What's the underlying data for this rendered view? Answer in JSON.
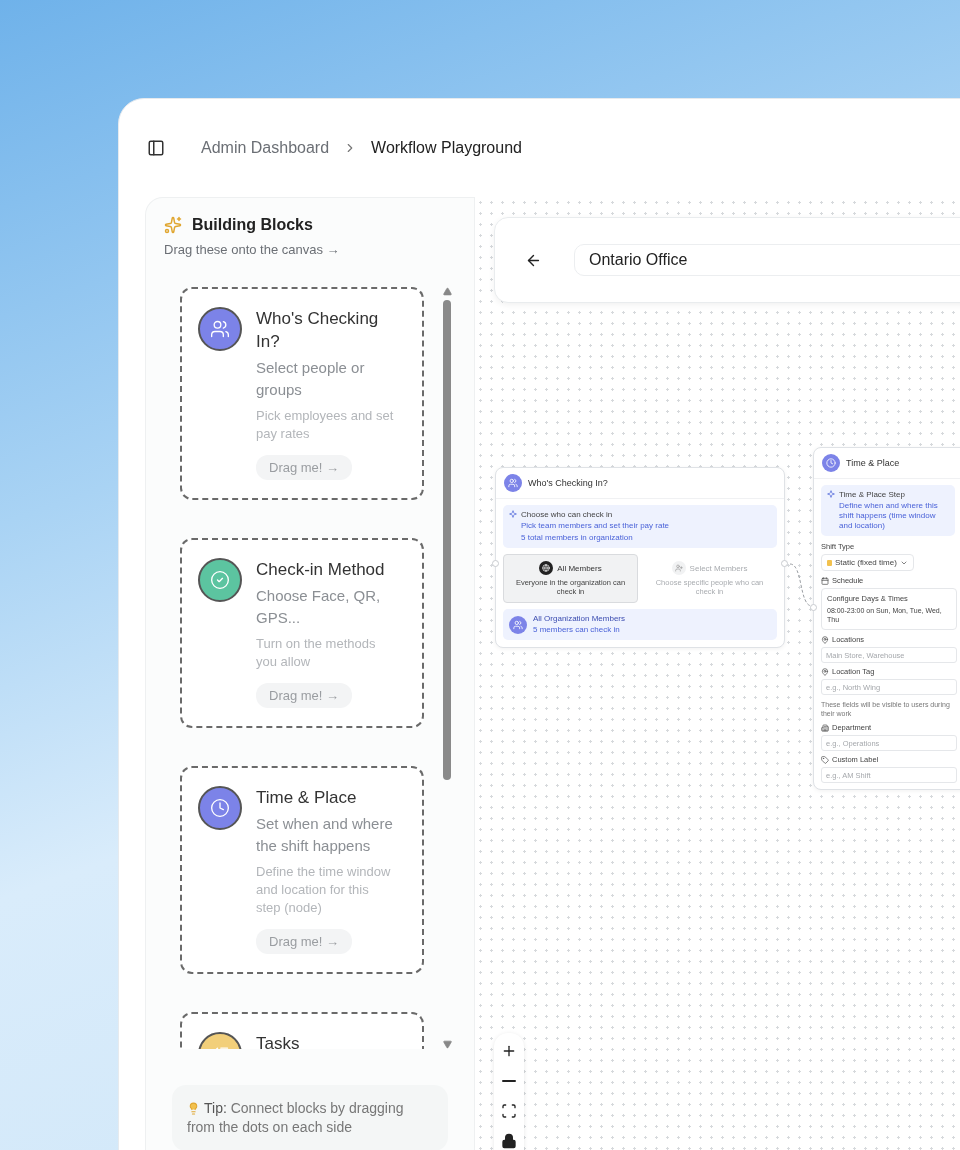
{
  "breadcrumb": [
    {
      "label": "Admin Dashboard",
      "current": false
    },
    {
      "label": "Workflow Playground",
      "current": true
    }
  ],
  "sidebar": {
    "title": "Building Blocks",
    "subtitle": "Drag these onto the canvas →",
    "blocks": [
      {
        "kind": "people",
        "color": "#7c83e8",
        "title": "Who's Checking In?",
        "subtitle": "Select people or groups",
        "description": "Pick employees and set pay rates",
        "action": "Drag me! →"
      },
      {
        "kind": "check",
        "color": "#5cc4a0",
        "title": "Check-in Method",
        "subtitle": "Choose Face, QR, GPS...",
        "description": "Turn on the methods you allow",
        "action": "Drag me! →"
      },
      {
        "kind": "clock",
        "color": "#7c83e8",
        "title": "Time & Place",
        "subtitle": "Set when and where the shift happens",
        "description": "Define the time window and location for this step (node)",
        "action": "Drag me! →"
      },
      {
        "kind": "tasks",
        "color": "#f2cf7a",
        "title": "Tasks"
      }
    ],
    "tip": {
      "label": "Tip:",
      "text": "Connect blocks by dragging from the dots on each side"
    }
  },
  "canvas": {
    "workflow_name": "Ontario Office",
    "who_node": {
      "title": "Who's Checking In?",
      "info_title": "Choose who can check in",
      "info_text": "Pick team members and set their pay rate",
      "info_count": "5 total members in organization",
      "options": [
        {
          "label": "All Members",
          "description": "Everyone in the organization can check in",
          "selected": true
        },
        {
          "label": "Select Members",
          "description": "Choose specific people who can check in",
          "selected": false
        }
      ],
      "summary_title": "All Organization Members",
      "summary_text": "5 members can check in"
    },
    "time_node": {
      "title": "Time & Place",
      "info_title": "Time & Place Step",
      "info_text": "Define when and where this shift happens (time window and location)",
      "shift_type_label": "Shift Type",
      "shift_type": "Static (fixed time)",
      "schedule_label": "Schedule",
      "schedule_title": "Configure Days & Times",
      "schedule_text": "08:00-23:00 on Sun, Mon, Tue, Wed, Thu",
      "fields_row1": [
        {
          "kind": "pin",
          "label": "Locations",
          "placeholder": "Main Store, Warehouse"
        },
        {
          "kind": "pin",
          "label": "Location Tag",
          "placeholder": "e.g., North Wing"
        }
      ],
      "note": "These fields will be visible to users during their work",
      "fields_row2": [
        {
          "kind": "building",
          "label": "Department",
          "placeholder": "e.g., Operations"
        },
        {
          "kind": "tag",
          "label": "Custom Label",
          "placeholder": "e.g., AM Shift"
        }
      ]
    },
    "zoom_controls": [
      {
        "kind": "zoom-in"
      },
      {
        "kind": "zoom-out"
      },
      {
        "kind": "fit"
      },
      {
        "kind": "lock"
      }
    ]
  }
}
